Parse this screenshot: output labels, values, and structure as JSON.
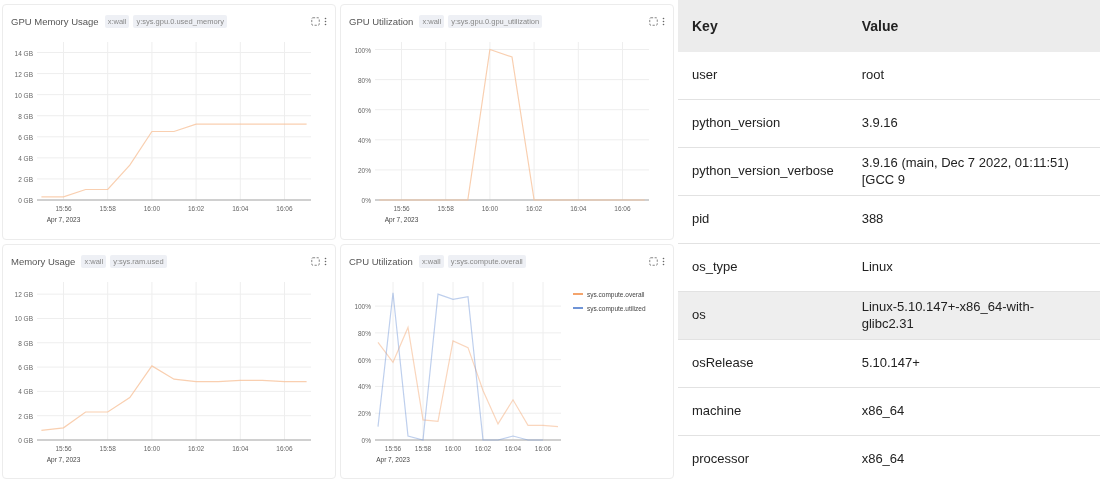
{
  "charts": [
    {
      "title": "GPU Memory Usage",
      "tags": [
        "x:wall",
        "y:sys.gpu.0.used_memory"
      ],
      "date_label": "Apr 7, 2023",
      "chart_data": {
        "type": "line",
        "categories": [
          null,
          "15:56",
          null,
          "15:58",
          null,
          "16:00",
          null,
          "16:02",
          null,
          "16:04",
          null,
          "16:06",
          null
        ],
        "series": [
          {
            "color": "#f7c39c",
            "values": [
              0.3,
              0.3,
              1,
              1,
              3.3,
              6.5,
              6.5,
              7.2,
              7.2,
              7.2,
              7.2,
              7.2,
              7.2
            ]
          }
        ],
        "ylim": [
          0,
          15
        ],
        "grid": true,
        "yticks": [
          {
            "value": 0,
            "label": "0 GB"
          },
          {
            "value": 2,
            "label": "2 GB"
          },
          {
            "value": 4,
            "label": "4 GB"
          },
          {
            "value": 6,
            "label": "6 GB"
          },
          {
            "value": 8,
            "label": "8 GB"
          },
          {
            "value": 10,
            "label": "10 GB"
          },
          {
            "value": 12,
            "label": "12 GB"
          },
          {
            "value": 14,
            "label": "14 GB"
          }
        ]
      }
    },
    {
      "title": "GPU Utilization",
      "tags": [
        "x:wall",
        "y:sys.gpu.0.gpu_utilization"
      ],
      "date_label": "Apr 7, 2023",
      "chart_data": {
        "type": "line",
        "categories": [
          null,
          "15:56",
          null,
          "15:58",
          null,
          "16:00",
          null,
          "16:02",
          null,
          "16:04",
          null,
          "16:06",
          null
        ],
        "series": [
          {
            "color": "#f7c39c",
            "values": [
              0,
              0,
              0,
              0,
              0,
              100,
              95,
              0,
              0,
              0,
              0,
              0,
              0
            ]
          }
        ],
        "ylim": [
          0,
          105
        ],
        "grid": true,
        "yticks": [
          {
            "value": 0,
            "label": "0%"
          },
          {
            "value": 20,
            "label": "20%"
          },
          {
            "value": 40,
            "label": "40%"
          },
          {
            "value": 60,
            "label": "60%"
          },
          {
            "value": 80,
            "label": "80%"
          },
          {
            "value": 100,
            "label": "100%"
          }
        ]
      }
    },
    {
      "title": "Memory Usage",
      "tags": [
        "x:wall",
        "y:sys.ram.used"
      ],
      "date_label": "Apr 7, 2023",
      "chart_data": {
        "type": "line",
        "categories": [
          null,
          "15:56",
          null,
          "15:58",
          null,
          "16:00",
          null,
          "16:02",
          null,
          "16:04",
          null,
          "16:06",
          null
        ],
        "series": [
          {
            "color": "#f7c39c",
            "values": [
              0.8,
              1,
              2.3,
              2.3,
              3.5,
              6.1,
              5,
              4.8,
              4.8,
              4.9,
              4.9,
              4.8,
              4.8
            ]
          }
        ],
        "ylim": [
          0,
          13
        ],
        "grid": true,
        "yticks": [
          {
            "value": 0,
            "label": "0 GB"
          },
          {
            "value": 2,
            "label": "2 GB"
          },
          {
            "value": 4,
            "label": "4 GB"
          },
          {
            "value": 6,
            "label": "6 GB"
          },
          {
            "value": 8,
            "label": "8 GB"
          },
          {
            "value": 10,
            "label": "10 GB"
          },
          {
            "value": 12,
            "label": "12 GB"
          }
        ]
      }
    },
    {
      "title": "CPU Utilization",
      "tags": [
        "x:wall",
        "y:sys.compute.overall"
      ],
      "date_label": "Apr 7, 2023",
      "chart_data": {
        "type": "line",
        "categories": [
          null,
          "15:56",
          null,
          "15:58",
          null,
          "16:00",
          null,
          "16:02",
          null,
          "16:04",
          null,
          "16:06",
          null
        ],
        "series": [
          {
            "name": "sys.compute.overall",
            "color": "#f4a46c",
            "values": [
              73,
              58,
              84,
              15,
              14,
              74,
              69,
              37,
              12,
              30,
              11,
              11,
              10
            ]
          },
          {
            "name": "sys.compute.utilized",
            "color": "#6f94d6",
            "values": [
              10,
              110,
              3,
              0,
              109,
              105,
              107,
              0,
              0,
              3,
              0,
              0,
              null
            ]
          }
        ],
        "ylim": [
          0,
          118
        ],
        "grid": true,
        "legend": "right",
        "yticks": [
          {
            "value": 0,
            "label": "0%"
          },
          {
            "value": 20,
            "label": "20%"
          },
          {
            "value": 40,
            "label": "40%"
          },
          {
            "value": 60,
            "label": "60%"
          },
          {
            "value": 80,
            "label": "80%"
          },
          {
            "value": 100,
            "label": "100%"
          }
        ]
      }
    }
  ],
  "table": {
    "columns": [
      "Key",
      "Value"
    ],
    "rows": [
      {
        "key": "user",
        "value": "root",
        "highlighted": false
      },
      {
        "key": "python_version",
        "value": "3.9.16",
        "highlighted": false
      },
      {
        "key": "python_version_verbose",
        "value": "3.9.16 (main, Dec 7 2022, 01:11:51) [GCC 9",
        "highlighted": false
      },
      {
        "key": "pid",
        "value": "388",
        "highlighted": false
      },
      {
        "key": "os_type",
        "value": "Linux",
        "highlighted": false
      },
      {
        "key": "os",
        "value": "Linux-5.10.147+-x86_64-with-glibc2.31",
        "highlighted": true
      },
      {
        "key": "osRelease",
        "value": "5.10.147+",
        "highlighted": false
      },
      {
        "key": "machine",
        "value": "x86_64",
        "highlighted": false
      },
      {
        "key": "processor",
        "value": "x86_64",
        "highlighted": false
      }
    ]
  }
}
